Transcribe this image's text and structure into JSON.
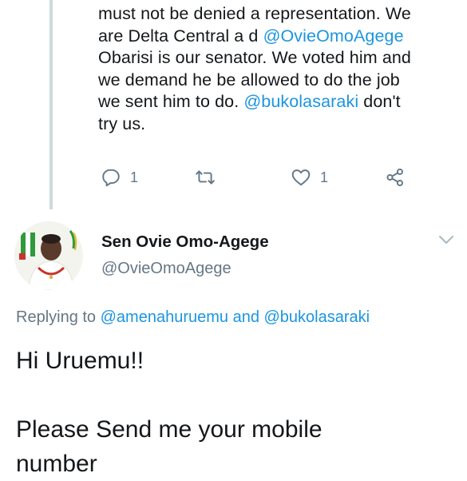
{
  "parent_tweet": {
    "lines": [
      [
        {
          "t": "must not be denied a representation. We",
          "m": false
        }
      ],
      [
        {
          "t": "are Delta Central a d ",
          "m": false
        },
        {
          "t": "@OvieOmoAgege",
          "m": true
        }
      ],
      [
        {
          "t": "Obarisi is our senator. We voted him and",
          "m": false
        }
      ],
      [
        {
          "t": "we demand he be allowed to do the job",
          "m": false
        }
      ],
      [
        {
          "t": "we sent him to do. ",
          "m": false
        },
        {
          "t": "@bukolasaraki",
          "m": true
        },
        {
          "t": " don't",
          "m": false
        }
      ],
      [
        {
          "t": "try us.",
          "m": false
        }
      ]
    ],
    "actions": {
      "reply_icon": "reply-icon",
      "reply_count": "1",
      "retweet_icon": "retweet-icon",
      "like_icon": "heart-icon",
      "like_count": "1",
      "share_icon": "share-icon"
    }
  },
  "reply_tweet": {
    "author_name": "Sen Ovie Omo-Agege",
    "author_handle": "@OvieOmoAgege",
    "menu_icon": "chevron-down-icon",
    "replying_prefix": "Replying to ",
    "replying_user_1": "@amenahuruemu",
    "replying_and": " and ",
    "replying_user_2": "@bukolasaraki",
    "text_line_1": "Hi Uruemu!!",
    "text_line_2": "",
    "text_line_3": "Please Send me your mobile",
    "text_line_4": "number"
  },
  "colors": {
    "link": "#1b95e0",
    "secondary": "#657786",
    "text": "#14171a",
    "thread_line": "#cfd9de"
  }
}
